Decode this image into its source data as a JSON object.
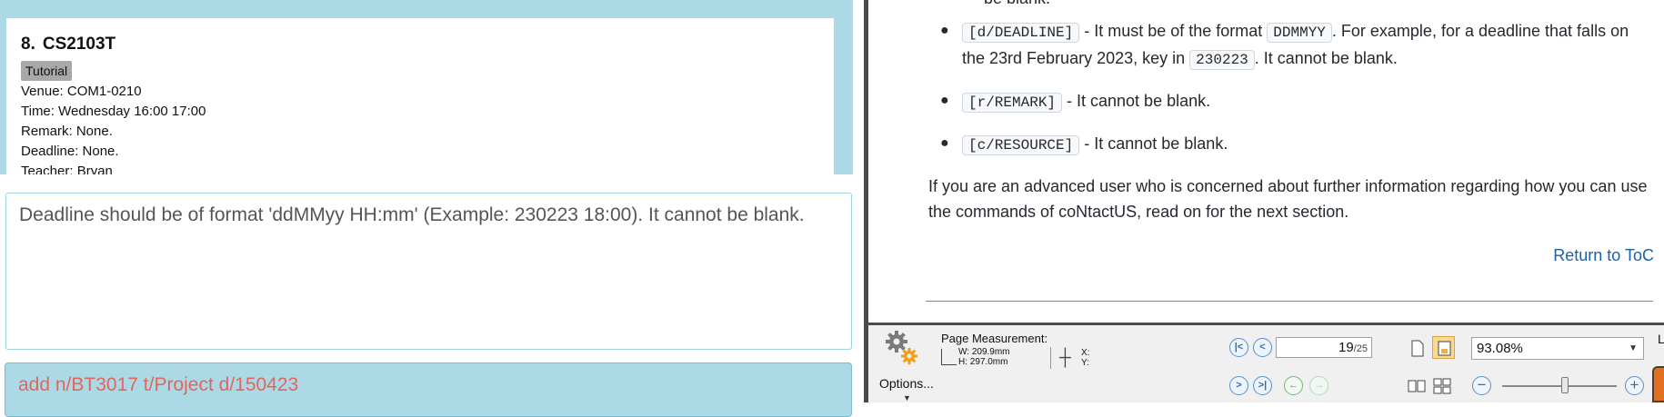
{
  "left_app": {
    "card": {
      "index": "8.",
      "module": "CS2103T",
      "tag": "Tutorial",
      "venue": "Venue: COM1-0210",
      "time": "Time: Wednesday 16:00 17:00",
      "remark": "Remark: None.",
      "deadline": "Deadline: None.",
      "teacher": "Teacher: Bryan"
    },
    "result_message": "Deadline should be of format 'ddMMyy HH:mm' (Example: 230223 18:00). It cannot be blank.",
    "command_input": "add n/BT3017 t/Project d/150423",
    "colors": {
      "panel_blue": "#abd9e6",
      "command_error_red": "#e0665f"
    }
  },
  "pdf_viewer": {
    "document": {
      "cut_top_line": "be blank.",
      "rules": [
        {
          "code": "[d/DEADLINE]",
          "text_before_code2": " - It must be of the format ",
          "code2": "DDMMYY",
          "text_mid": ". For example, for a deadline that falls on the 23rd February 2023, key in ",
          "code3": "230223",
          "text_end": ". It cannot be blank."
        },
        {
          "code": "[r/REMARK]",
          "text": " - It cannot be blank."
        },
        {
          "code": "[c/RESOURCE]",
          "text": " - It cannot be blank."
        }
      ],
      "advanced_paragraph": "If you are an advanced user who is concerned about further information regarding how you can use the commands of coNtactUS, read on for the next section.",
      "return_link": "Return to ToC"
    },
    "toolbar": {
      "options_label": "Options...",
      "page_measurement_label": "Page Measurement:",
      "width": "W: 209.9mm",
      "height": "H: 297.0mm",
      "x_label": "X:",
      "y_label": "Y:",
      "current_page": "19",
      "total_pages": "/25",
      "zoom": "93.08%",
      "zoom_slider_fraction": 0.55,
      "edge_letter": "L"
    }
  }
}
